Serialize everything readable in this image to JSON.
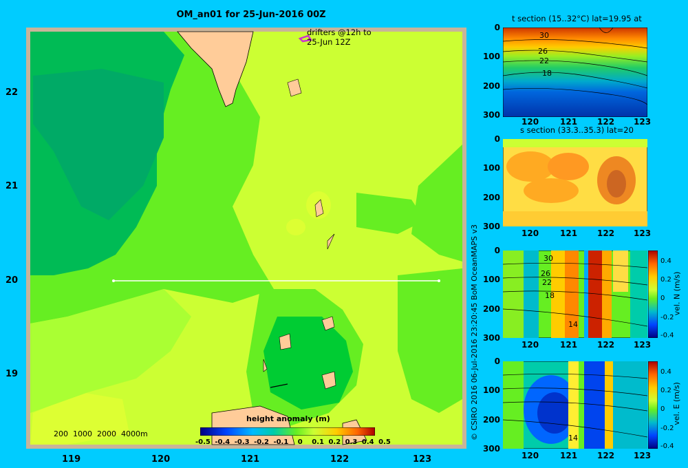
{
  "map": {
    "title": "OM_an01 for 25-Jun-2016 00Z",
    "drifters_label_1": "drifters @12h to",
    "drifters_label_2": "25-Jun 12Z",
    "depth_legend": "200  1000  2000  4000m",
    "lat_ticks": [
      "22",
      "21",
      "20",
      "19"
    ],
    "lon_ticks": [
      "119",
      "120",
      "121",
      "122",
      "123"
    ],
    "colorbar_title": "height anomaly  (m)",
    "colorbar_ticks": [
      "-0.5",
      "-0.4",
      "-0.3",
      "-0.2",
      "-0.1",
      "0",
      "0.1",
      "0.2",
      "0.3",
      "0.4",
      "0.5"
    ],
    "section_line_lat": "20"
  },
  "panels": {
    "t_section": {
      "title": "t section (15..32°C) lat=19.95 at",
      "contour_labels": [
        "30",
        "26",
        "22",
        "18"
      ]
    },
    "s_section": {
      "title": "s section (33.3..35.3) lat=20"
    },
    "vn_section": {
      "side_label": "vel. N (m/s)",
      "contour_labels": [
        "30",
        "26",
        "22",
        "18",
        "14"
      ]
    },
    "ve_section": {
      "side_label": "vel. E (m/s)",
      "contour_labels": [
        "14"
      ]
    },
    "depth_ticks": [
      "0",
      "100",
      "200",
      "300"
    ],
    "lon_ticks": [
      "120",
      "121",
      "122",
      "123"
    ],
    "vel_colorbar_ticks": [
      "0.4",
      "0.2",
      "0",
      "-0.2",
      "-0.4"
    ]
  },
  "credit": "© CSIRO 2016   06-Jul-2016 23:20:45 BoM OceanMAPS v3",
  "colors": {
    "background": "#00ccff",
    "land": "#ffcc99",
    "land_outline": "#c8b49a",
    "light_green": "#ccff33",
    "mid_green": "#66ee22",
    "dark_green": "#00bb55",
    "drifter": "#cc33cc"
  }
}
